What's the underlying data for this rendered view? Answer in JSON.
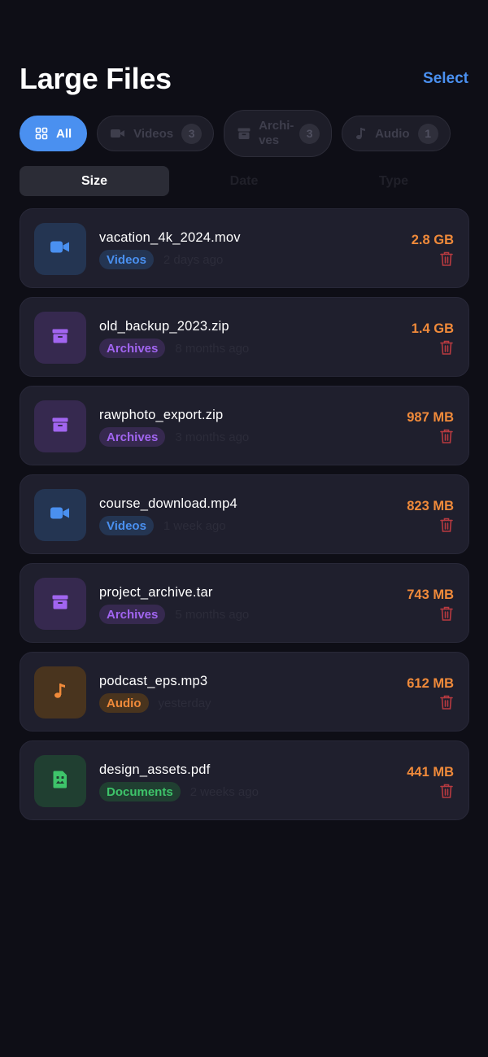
{
  "header": {
    "title": "Large Files",
    "select_label": "Select"
  },
  "filters": [
    {
      "label": "All",
      "icon": "grid-icon",
      "active": true
    },
    {
      "label": "Videos",
      "count": "3",
      "icon": "video-icon"
    },
    {
      "label_line1": "Archi-",
      "label_line2": "ves",
      "count": "3",
      "icon": "archive-icon"
    },
    {
      "label": "Audio",
      "count": "1",
      "icon": "music-note-icon"
    }
  ],
  "sort": [
    {
      "label": "Size",
      "active": true
    },
    {
      "label": "Date"
    },
    {
      "label": "Type"
    }
  ],
  "files": [
    {
      "name": "vacation_4k_2024.mov",
      "category": "Videos",
      "age": "2 days ago",
      "size": "2.8 GB",
      "icon": "video-icon"
    },
    {
      "name": "old_backup_2023.zip",
      "category": "Archives",
      "age": "8 months ago",
      "size": "1.4 GB",
      "icon": "archive-icon"
    },
    {
      "name": "rawphoto_export.zip",
      "category": "Archives",
      "age": "3 months ago",
      "size": "987 MB",
      "icon": "archive-icon"
    },
    {
      "name": "course_download.mp4",
      "category": "Videos",
      "age": "1 week ago",
      "size": "823 MB",
      "icon": "video-icon"
    },
    {
      "name": "project_archive.tar",
      "category": "Archives",
      "age": "5 months ago",
      "size": "743 MB",
      "icon": "archive-icon"
    },
    {
      "name": "podcast_eps.mp3",
      "category": "Audio",
      "age": "yesterday",
      "size": "612 MB",
      "icon": "music-note-icon"
    },
    {
      "name": "design_assets.pdf",
      "category": "Documents",
      "age": "2 weeks ago",
      "size": "441 MB",
      "icon": "document-icon"
    }
  ],
  "colors": {
    "accent": "#4a90f0",
    "videos": "#4a90f0",
    "archives": "#a165f0",
    "audio": "#f08a3a",
    "documents": "#3ec46a",
    "size": "#f08a3a",
    "delete": "#e5484d"
  }
}
